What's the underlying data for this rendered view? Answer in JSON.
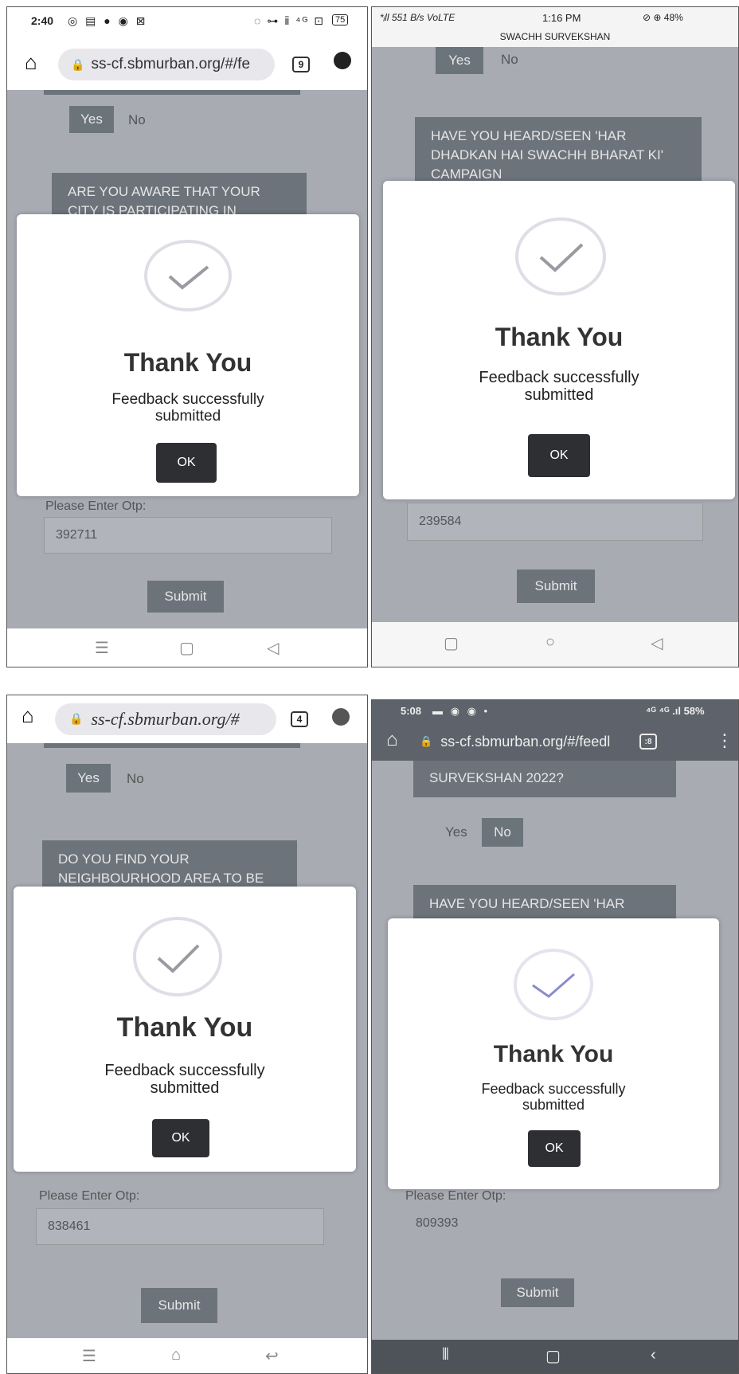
{
  "panels": [
    {
      "status": {
        "time": "2:40",
        "left_icons": "◎ ▤ ● ◉ ⊠",
        "right_icons": "◌ ⊶ ⅱ ⁴ᴳ ⊡",
        "battery": "75"
      },
      "url": "ss-cf.sbmurban.org/#/fe",
      "tab_count": "9",
      "yes": "Yes",
      "no": "No",
      "question": "ARE YOU AWARE THAT YOUR CITY IS PARTICIPATING IN",
      "otp_label": "Please Enter Otp:",
      "otp_value": "392711",
      "submit": "Submit",
      "modal": {
        "title": "Thank You",
        "message": "Feedback successfully submitted",
        "ok": "OK"
      }
    },
    {
      "status": {
        "network": "*ᵢll 551 B/s VoLTE",
        "time": "1:16 PM",
        "right": "⊘ ⊕ 48%",
        "app_title": "SWACHH SURVEKSHAN"
      },
      "yes": "Yes",
      "no": "No",
      "question": "HAVE YOU HEARD/SEEN 'HAR DHADKAN HAI SWACHH BHARAT KI' CAMPAIGN",
      "otp_value": "239584",
      "submit": "Submit",
      "modal": {
        "title": "Thank You",
        "message": "Feedback successfully submitted",
        "ok": "OK"
      }
    },
    {
      "url": "ss-cf.sbmurban.org/#",
      "tab_count": "4",
      "yes": "Yes",
      "no": "No",
      "question": "DO YOU FIND YOUR NEIGHBOURHOOD AREA TO BE",
      "otp_label": "Please Enter Otp:",
      "otp_value": "838461",
      "submit": "Submit",
      "modal": {
        "title": "Thank You",
        "message": "Feedback successfully submitted",
        "ok": "OK"
      }
    },
    {
      "status": {
        "time": "5:08",
        "left_icons": "▬ ◉ ◉ •",
        "right": "⁴ᴳ ⁴ᴳ .ıl 58%"
      },
      "url": "ss-cf.sbmurban.org/#/feedl",
      "tab_count": ":8",
      "prev_question": "SURVEKSHAN 2022?",
      "yes": "Yes",
      "no": "No",
      "question": "HAVE YOU HEARD/SEEN 'HAR",
      "otp_label": "Please Enter Otp:",
      "otp_value": "809393",
      "submit": "Submit",
      "modal": {
        "title": "Thank You",
        "message": "Feedback successfully submitted",
        "ok": "OK"
      }
    }
  ],
  "colors": {
    "overlay": "#a9abb3",
    "dark_box": "#6c737b",
    "ok_button": "#2e2f33"
  }
}
